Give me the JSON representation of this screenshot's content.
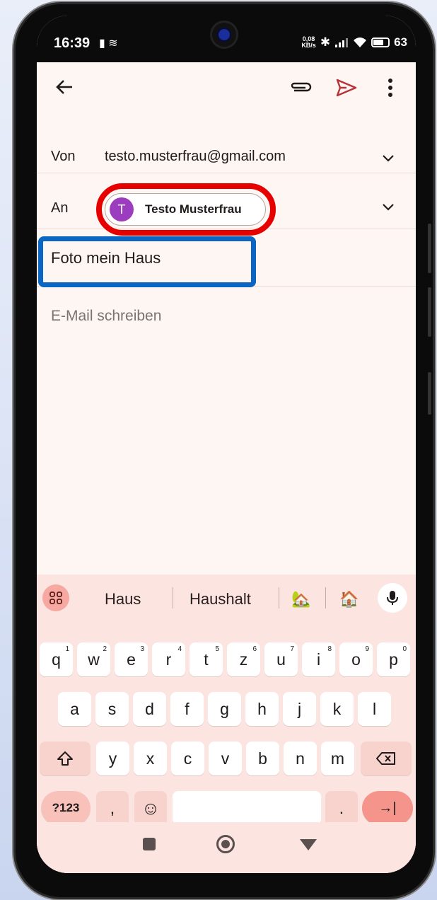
{
  "status": {
    "time": "16:39",
    "net_speed_value": "0,08",
    "net_speed_unit": "KB/s",
    "battery": "63"
  },
  "toolbar": {
    "icons": [
      "back-arrow-icon",
      "attachment-icon",
      "send-icon",
      "more-vert-icon"
    ]
  },
  "compose": {
    "from_label": "Von",
    "from_value": "testo.musterfrau@gmail.com",
    "to_label": "An",
    "recipient_initial": "T",
    "recipient_name": "Testo Musterfrau",
    "subject": "Foto mein Haus",
    "body_placeholder": "E-Mail schreiben"
  },
  "colors": {
    "annotation_red": "#e60000",
    "annotation_blue": "#0a66c2",
    "avatar": "#9c3dbf",
    "send_accent": "#b8323a"
  },
  "keyboard": {
    "suggestions": [
      "Haus",
      "Haushalt",
      "🏡",
      "🏠"
    ],
    "row1": [
      {
        "k": "q",
        "n": "1"
      },
      {
        "k": "w",
        "n": "2"
      },
      {
        "k": "e",
        "n": "3"
      },
      {
        "k": "r",
        "n": "4"
      },
      {
        "k": "t",
        "n": "5"
      },
      {
        "k": "z",
        "n": "6"
      },
      {
        "k": "u",
        "n": "7"
      },
      {
        "k": "i",
        "n": "8"
      },
      {
        "k": "o",
        "n": "9"
      },
      {
        "k": "p",
        "n": "0"
      }
    ],
    "row2": [
      "a",
      "s",
      "d",
      "f",
      "g",
      "h",
      "j",
      "k",
      "l"
    ],
    "row3": [
      "y",
      "x",
      "c",
      "v",
      "b",
      "n",
      "m"
    ],
    "symbols_label": "?123",
    "comma": ",",
    "period": ".",
    "emoji": "☺",
    "enter": "→|"
  }
}
